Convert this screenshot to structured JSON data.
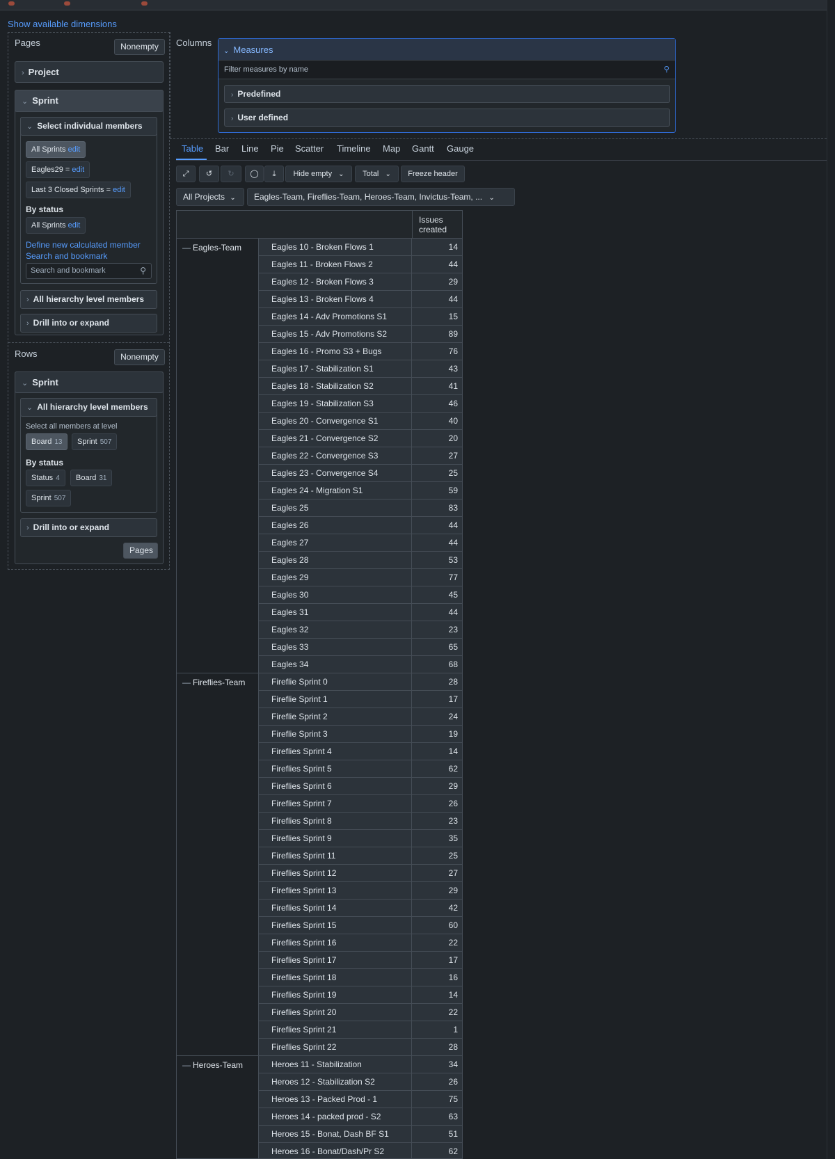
{
  "show_dimensions": "Show available dimensions",
  "pages": {
    "label": "Pages",
    "nonempty": "Nonempty",
    "project": "Project",
    "sprint": "Sprint",
    "select_individual": "Select individual members",
    "members": [
      {
        "text": "All Sprints",
        "edit": "edit"
      },
      {
        "text": "Eagles29 =",
        "edit": "edit"
      },
      {
        "text": "Last 3 Closed Sprints =",
        "edit": "edit"
      }
    ],
    "by_status": "By status",
    "status_member": {
      "text": "All Sprints",
      "edit": "edit"
    },
    "define_calc": "Define new calculated member",
    "search_bookmark": "Search and bookmark",
    "search_placeholder": "Search and bookmark",
    "all_hierarchy": "All hierarchy level members",
    "drill": "Drill into or expand"
  },
  "rows": {
    "label": "Rows",
    "nonempty": "Nonempty",
    "sprint": "Sprint",
    "all_hierarchy": "All hierarchy level members",
    "select_all_at_level": "Select all members at level",
    "levels": [
      {
        "name": "Board",
        "count": "13"
      },
      {
        "name": "Sprint",
        "count": "507"
      }
    ],
    "by_status": "By status",
    "status_levels": [
      {
        "name": "Status",
        "count": "4"
      },
      {
        "name": "Board",
        "count": "31"
      },
      {
        "name": "Sprint",
        "count": "507"
      }
    ],
    "drill": "Drill into or expand",
    "pages_button": "Pages"
  },
  "columns": {
    "label": "Columns",
    "measures": "Measures",
    "filter_placeholder": "Filter measures by name",
    "predefined": "Predefined",
    "user_defined": "User defined"
  },
  "tabs": [
    "Table",
    "Bar",
    "Line",
    "Pie",
    "Scatter",
    "Timeline",
    "Map",
    "Gantt",
    "Gauge"
  ],
  "toolbar": {
    "hide_empty": "Hide empty",
    "total": "Total",
    "freeze_header": "Freeze header"
  },
  "filters": {
    "projects": "All Projects",
    "teams": "Eagles-Team, Fireflies-Team, Heroes-Team, Invictus-Team, ..."
  },
  "table": {
    "measure_header": "Issues created",
    "groups": [
      {
        "name": "Eagles-Team",
        "rows": [
          [
            "Eagles 10 - Broken Flows 1",
            "14"
          ],
          [
            "Eagles 11 - Broken Flows 2",
            "44"
          ],
          [
            "Eagles 12 - Broken Flows 3",
            "29"
          ],
          [
            "Eagles 13 - Broken Flows 4",
            "44"
          ],
          [
            "Eagles 14 - Adv Promotions S1",
            "15"
          ],
          [
            "Eagles 15 - Adv Promotions S2",
            "89"
          ],
          [
            "Eagles 16 - Promo S3 + Bugs",
            "76"
          ],
          [
            "Eagles 17 - Stabilization S1",
            "43"
          ],
          [
            "Eagles 18 - Stabilization S2",
            "41"
          ],
          [
            "Eagles 19 - Stabilization S3",
            "46"
          ],
          [
            "Eagles 20 - Convergence S1",
            "40"
          ],
          [
            "Eagles 21 - Convergence S2",
            "20"
          ],
          [
            "Eagles 22 - Convergence S3",
            "27"
          ],
          [
            "Eagles 23 - Convergence S4",
            "25"
          ],
          [
            "Eagles 24 - Migration S1",
            "59"
          ],
          [
            "Eagles 25",
            "83"
          ],
          [
            "Eagles 26",
            "44"
          ],
          [
            "Eagles 27",
            "44"
          ],
          [
            "Eagles 28",
            "53"
          ],
          [
            "Eagles 29",
            "77"
          ],
          [
            "Eagles 30",
            "45"
          ],
          [
            "Eagles 31",
            "44"
          ],
          [
            "Eagles 32",
            "23"
          ],
          [
            "Eagles 33",
            "65"
          ],
          [
            "Eagles 34",
            "68"
          ]
        ]
      },
      {
        "name": "Fireflies-Team",
        "rows": [
          [
            "Fireflie Sprint 0",
            "28"
          ],
          [
            "Fireflie Sprint 1",
            "17"
          ],
          [
            "Fireflie Sprint 2",
            "24"
          ],
          [
            "Fireflie Sprint 3",
            "19"
          ],
          [
            "Fireflies Sprint 4",
            "14"
          ],
          [
            "Fireflies Sprint 5",
            "62"
          ],
          [
            "Fireflies Sprint 6",
            "29"
          ],
          [
            "Fireflies Sprint 7",
            "26"
          ],
          [
            "Fireflies Sprint 8",
            "23"
          ],
          [
            "Fireflies Sprint 9",
            "35"
          ],
          [
            "Fireflies Sprint 11",
            "25"
          ],
          [
            "Fireflies Sprint 12",
            "27"
          ],
          [
            "Fireflies Sprint 13",
            "29"
          ],
          [
            "Fireflies Sprint 14",
            "42"
          ],
          [
            "Fireflies Sprint 15",
            "60"
          ],
          [
            "Fireflies Sprint 16",
            "22"
          ],
          [
            "Fireflies Sprint 17",
            "17"
          ],
          [
            "Fireflies Sprint 18",
            "16"
          ],
          [
            "Fireflies Sprint 19",
            "14"
          ],
          [
            "Fireflies Sprint 20",
            "22"
          ],
          [
            "Fireflies Sprint 21",
            "1"
          ],
          [
            "Fireflies Sprint 22",
            "28"
          ]
        ]
      },
      {
        "name": "Heroes-Team",
        "rows": [
          [
            "Heroes 11 - Stabilization",
            "34"
          ],
          [
            "Heroes 12 - Stabilization S2",
            "26"
          ],
          [
            "Heroes 13 - Packed Prod - 1",
            "75"
          ],
          [
            "Heroes 14 - packed prod - S2",
            "63"
          ],
          [
            "Heroes 15 - Bonat, Dash BF S1",
            "51"
          ],
          [
            "Heroes 16 - Bonat/Dash/Pr S2",
            "62"
          ]
        ]
      }
    ]
  }
}
